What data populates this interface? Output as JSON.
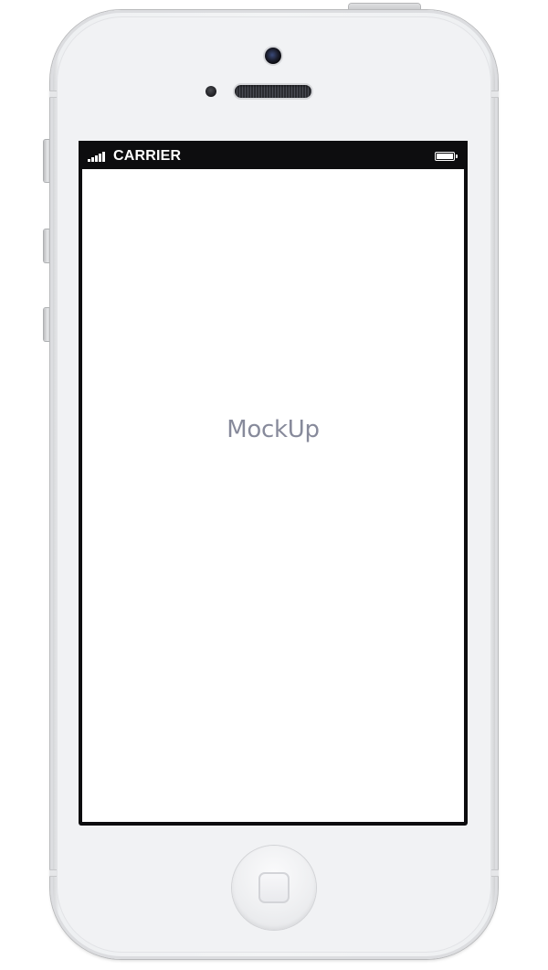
{
  "status_bar": {
    "carrier": "CARRIER",
    "signal_bars": 5,
    "battery_level": 1.0,
    "signal_icon": "signal-strength-icon",
    "battery_icon": "battery-icon"
  },
  "screen": {
    "label": "MockUp"
  },
  "colors": {
    "status_bar_bg": "#0d0d0f",
    "label_text": "#878a9b",
    "phone_body": "#f1f2f4"
  }
}
